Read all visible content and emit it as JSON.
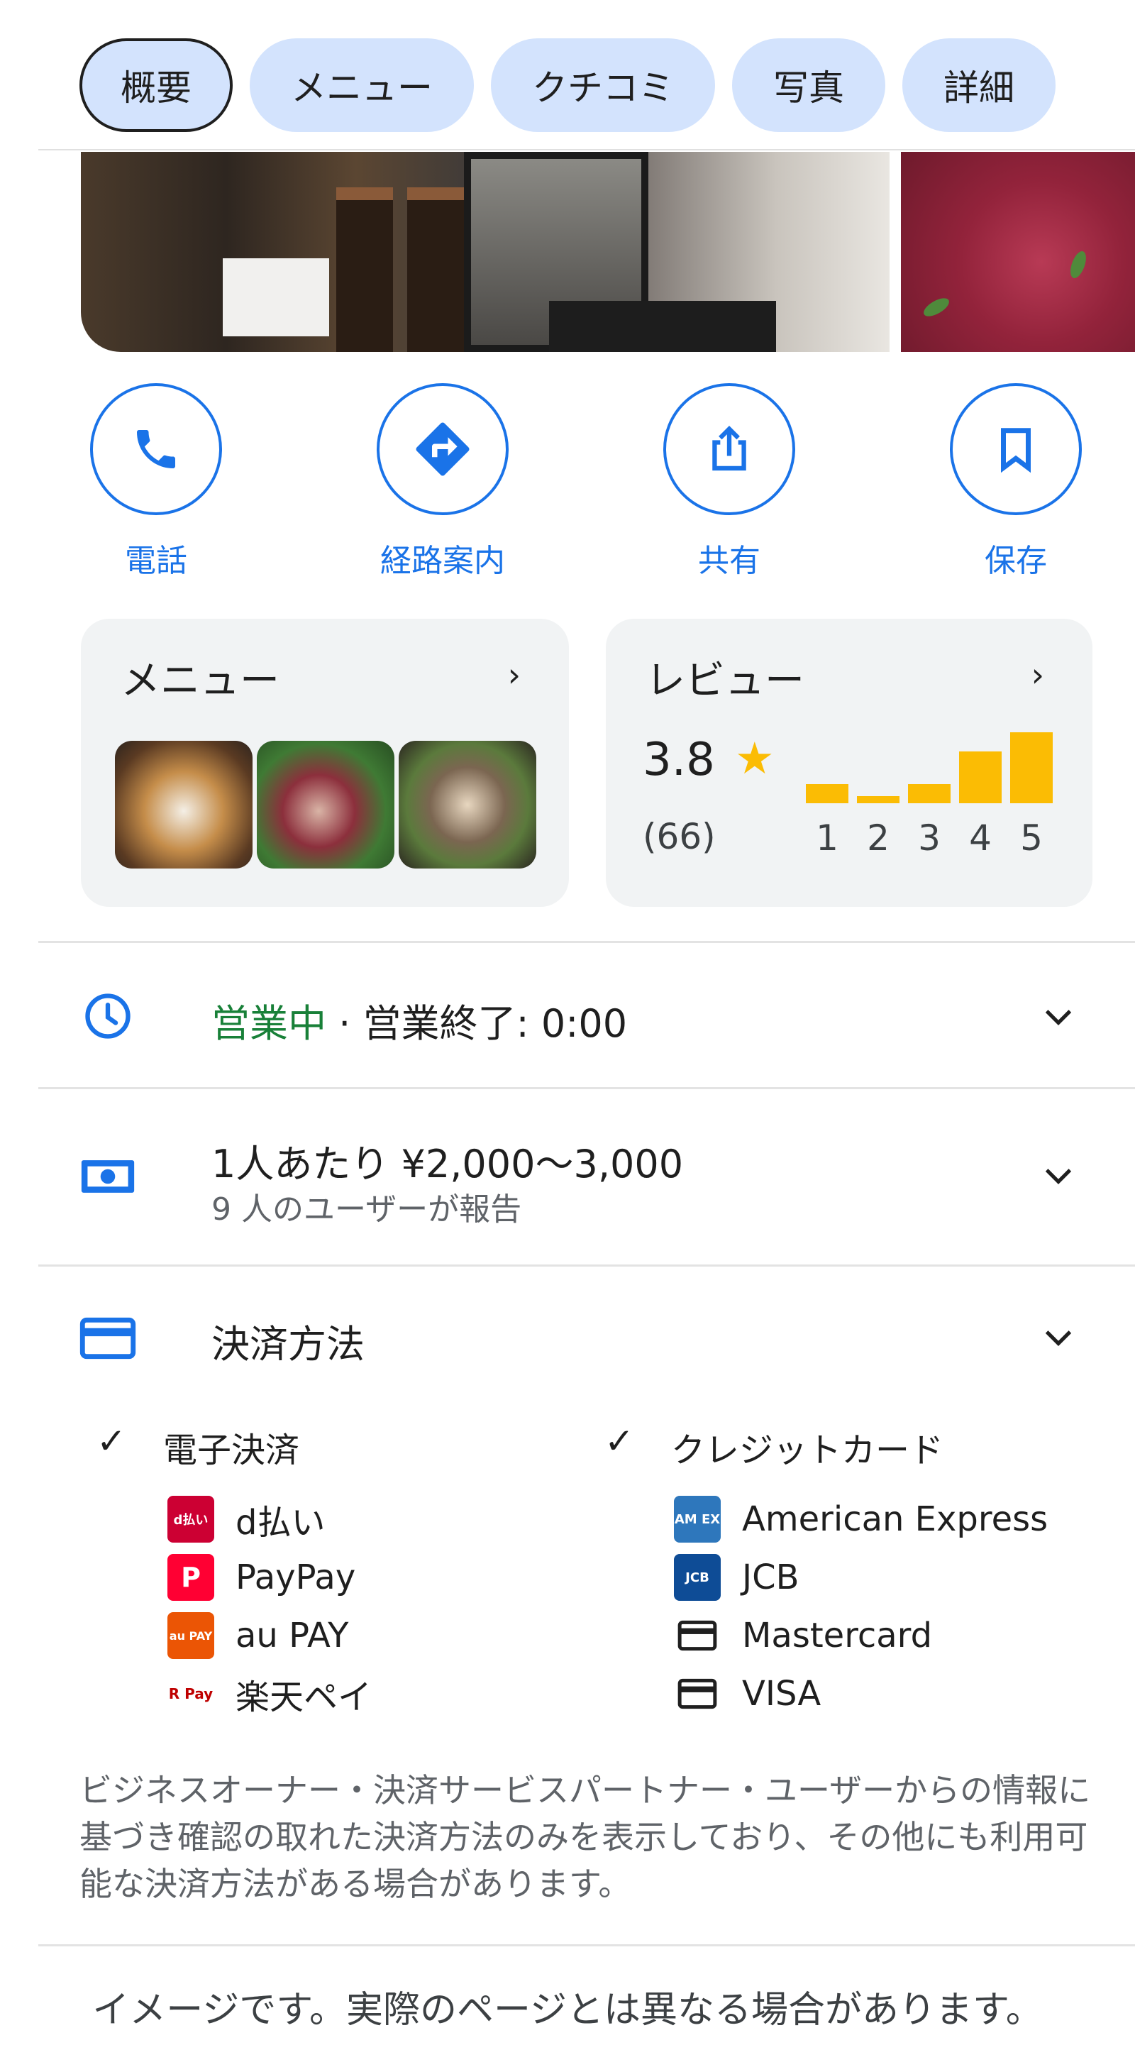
{
  "tabs": [
    {
      "label": "概要",
      "active": true
    },
    {
      "label": "メニュー",
      "active": false
    },
    {
      "label": "クチコミ",
      "active": false
    },
    {
      "label": "写真",
      "active": false
    },
    {
      "label": "詳細",
      "active": false
    }
  ],
  "actions": [
    {
      "label": "電話",
      "icon": "phone-icon"
    },
    {
      "label": "経路案内",
      "icon": "directions-icon"
    },
    {
      "label": "共有",
      "icon": "share-icon"
    },
    {
      "label": "保存",
      "icon": "bookmark-icon"
    }
  ],
  "menu_card": {
    "title": "メニュー",
    "chevron": "›"
  },
  "review_card": {
    "title": "レビュー",
    "chevron": "›",
    "rating": "3.8",
    "star": "★",
    "count": "(66)",
    "distribution": [
      {
        "stars": "1",
        "share": 0.27
      },
      {
        "stars": "2",
        "share": 0.09
      },
      {
        "stars": "3",
        "share": 0.27
      },
      {
        "stars": "4",
        "share": 0.73
      },
      {
        "stars": "5",
        "share": 1.0
      }
    ]
  },
  "hours": {
    "status": "営業中",
    "separator": " · ",
    "detail": "営業終了: 0:00"
  },
  "price": {
    "text": "1人あたり ¥2,000〜3,000",
    "sub": "9 人のユーザーが報告"
  },
  "payment": {
    "title": "決済方法",
    "check": "✓",
    "electronic": {
      "heading": "電子決済",
      "items": [
        {
          "name": "d払い",
          "logo": "d払い",
          "color": "#cc0033"
        },
        {
          "name": "PayPay",
          "logo": "P",
          "color": "#ff0033"
        },
        {
          "name": "au PAY",
          "logo": "au PAY",
          "color": "#eb5505"
        },
        {
          "name": "楽天ペイ",
          "logo": "R Pay",
          "color": "#bf0000"
        }
      ]
    },
    "credit": {
      "heading": "クレジットカード",
      "items": [
        {
          "name": "American Express",
          "logo": "AM EX",
          "color": "#2e77bc"
        },
        {
          "name": "JCB",
          "logo": "JCB",
          "color": "#0e4c96"
        },
        {
          "name": "Mastercard",
          "logo": "card",
          "color": "#1f1f1f"
        },
        {
          "name": "VISA",
          "logo": "card",
          "color": "#1f1f1f"
        }
      ]
    },
    "disclaimer": "ビジネスオーナー・決済サービスパートナー・ユーザーからの情報に基づき確認の取れた決済方法のみを表示しており、その他にも利用可能な決済方法がある場合があります。"
  },
  "footer_note": "イメージです。実際のページとは異なる場合があります。",
  "colors": {
    "accent": "#1a73e8",
    "star": "#fbbc04",
    "open": "#188038",
    "chip": "#d3e3fd",
    "card": "#f1f3f4"
  }
}
